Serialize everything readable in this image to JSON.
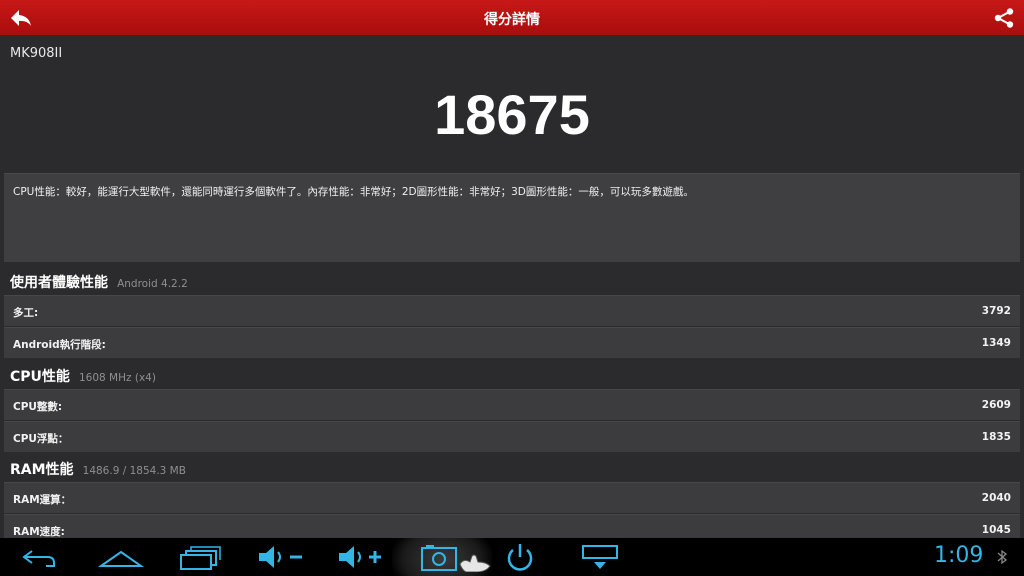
{
  "header": {
    "title": "得分詳情",
    "back_icon": "back-arrow-icon",
    "share_icon": "share-icon"
  },
  "device_name": "MK908II",
  "total_score": "18675",
  "description": "CPU性能：較好，能運行大型軟件，還能同時運行多個軟件了。內存性能：非常好；2D圖形性能：非常好；3D圖形性能：一般，可以玩多數遊戲。",
  "sections": [
    {
      "name": "使用者體驗性能",
      "sub": "Android 4.2.2",
      "rows": [
        {
          "label": "多工:",
          "value": "3792"
        },
        {
          "label": "Android執行階段:",
          "value": "1349"
        }
      ]
    },
    {
      "name": "CPU性能",
      "sub": "1608 MHz (x4)",
      "rows": [
        {
          "label": "CPU整數:",
          "value": "2609"
        },
        {
          "label": "CPU浮點：",
          "value": "1835"
        }
      ]
    },
    {
      "name": "RAM性能",
      "sub": "1486.9 / 1854.3 MB",
      "rows": [
        {
          "label": "RAM運算：",
          "value": "2040"
        },
        {
          "label": "RAM速度:",
          "value": "1045"
        }
      ]
    }
  ],
  "navbar": {
    "clock": "1:09",
    "icon_color": "#33b5e5",
    "buttons": [
      "back-icon",
      "home-icon",
      "recent-apps-icon",
      "volume-down-icon",
      "volume-up-icon",
      "screenshot-camera-icon",
      "power-icon",
      "hide-bar-icon"
    ],
    "status_icon": "bluetooth-icon"
  },
  "colors": {
    "header_red": "#c81818",
    "background": "#2b2b2d",
    "row_bg": "#3c3c3f"
  }
}
